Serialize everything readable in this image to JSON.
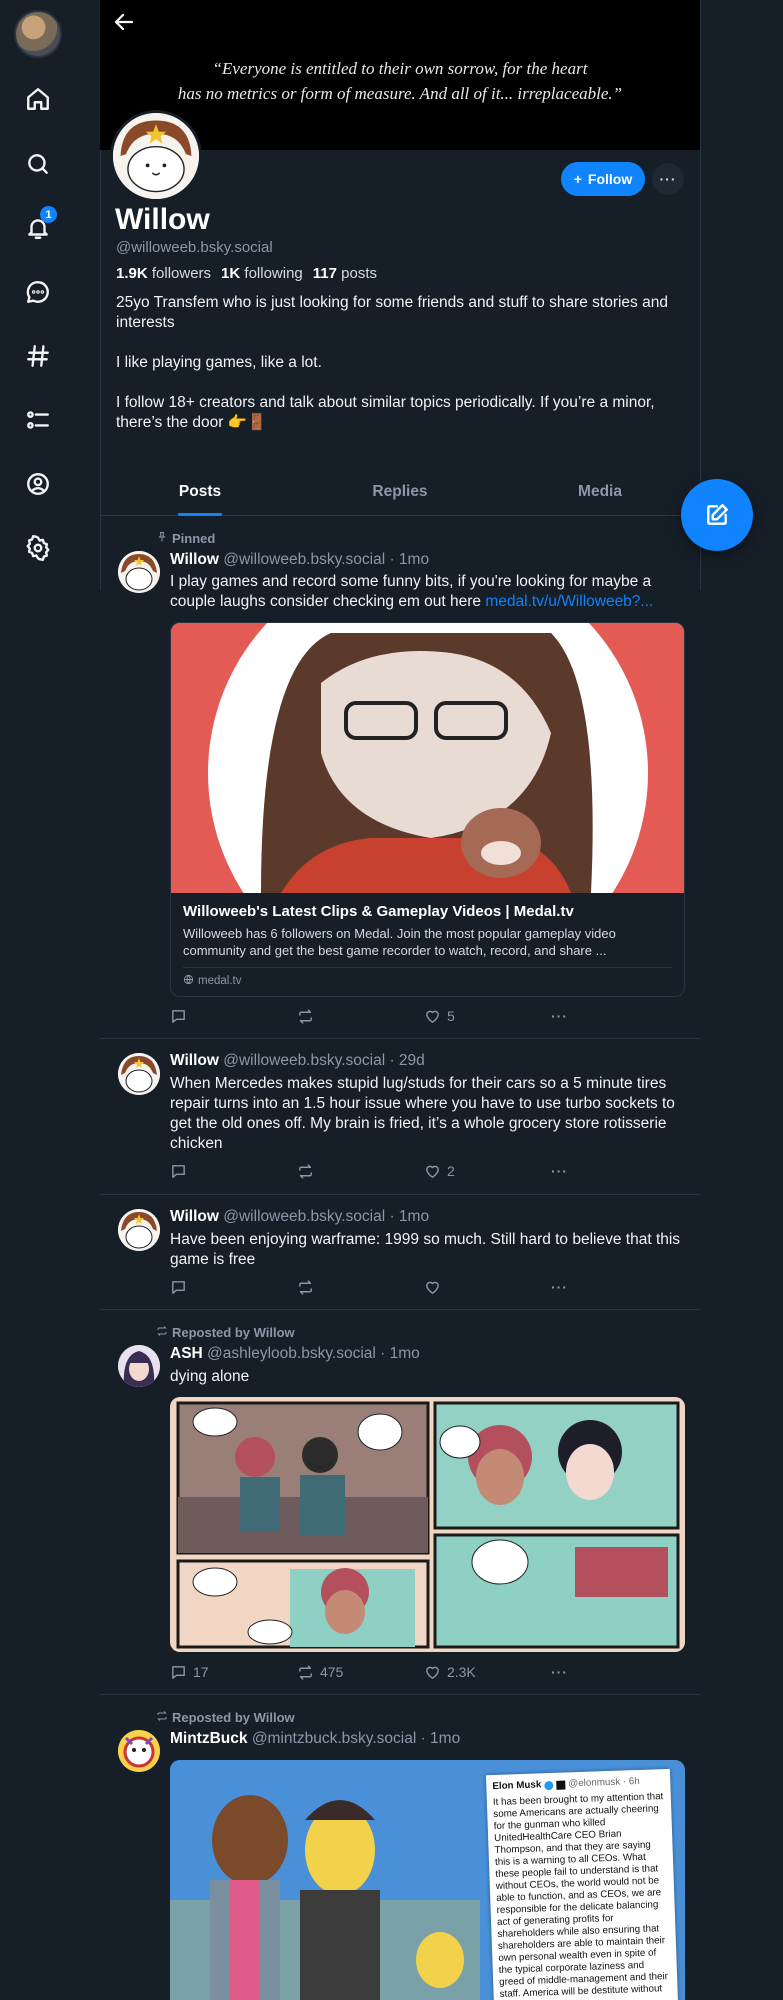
{
  "nav": {
    "notifications_badge": "1"
  },
  "banner": {
    "quote": "“Everyone is entitled to their own sorrow, for the heart\nhas no metrics or form of measure. And all of it... irreplaceable.”"
  },
  "profile": {
    "display_name": "Willow",
    "handle": "@willoweeb.bsky.social",
    "followers_count": "1.9K",
    "followers_label": "followers",
    "following_count": "1K",
    "following_label": "following",
    "posts_count": "117",
    "posts_label": "posts",
    "bio": [
      "25yo Transfem who is just looking for some friends and stuff to share stories and interests",
      "I like playing games, like a lot.",
      "",
      "I follow 18+ creators and talk about similar topics periodically. If you’re a minor, there’s the door 👉🚪"
    ],
    "follow_label": "Follow",
    "more_label": "···"
  },
  "tabs": [
    "Posts",
    "Replies",
    "Media"
  ],
  "feed": [
    {
      "meta": "Pinned",
      "author": "Willow",
      "handle": "@willoweeb.bsky.social · 1mo",
      "text": "I play games and record some funny bits, if you're looking for maybe a couple laughs consider checking em out here ",
      "link": "medal.tv/u/Willoweeb?...",
      "embed": {
        "title": "Willoweeb's Latest Clips & Gameplay Videos | Medal.tv",
        "description": "Willoweeb has 6 followers on Medal. Join the most popular gameplay video community and get the best game recorder to watch, record, and share ...",
        "domain": "medal.tv"
      },
      "replies": "",
      "reposts": "",
      "likes": "5"
    },
    {
      "author": "Willow",
      "handle": "@willoweeb.bsky.social · 29d",
      "text": "When Mercedes makes stupid lug/studs for their cars so a 5 minute tires repair turns into an 1.5 hour issue where you have to use turbo sockets to get the old ones off. My brain is fried, it’s a whole grocery store rotisserie chicken",
      "replies": "",
      "reposts": "",
      "likes": "2"
    },
    {
      "author": "Willow",
      "handle": "@willoweeb.bsky.social · 1mo",
      "text": "Have been enjoying warframe: 1999 so much. Still hard to believe that this game is free",
      "replies": "",
      "reposts": "",
      "likes": ""
    },
    {
      "meta": "Reposted by Willow",
      "author": "ASH",
      "handle": "@ashleyloob.bsky.social · 1mo",
      "text": "dying alone",
      "replies": "17",
      "reposts": "475",
      "likes": "2.3K"
    },
    {
      "meta": "Reposted by Willow",
      "author": "MintzBuck",
      "handle": "@mintzbuck.bsky.social · 1mo",
      "image_text": {
        "name": "Elon Musk",
        "handle": "@elonmusk · 6h",
        "body": "It has been brought to my attention that some Americans are actually cheering for the gunman who killed UnitedHealthCare CEO Brian Thompson, and that they are saying this is a warning to all CEOs. What these people fail to understand is that without CEOs, the world would not be able to function, and as CEOs, we are responsible for the delicate balancing act of generating profits for shareholders while also ensuring that shareholders are able to maintain their own personal wealth even in spite of the typical corporate laziness and greed of middle-management and their staff. America will be destitute without us. #DOGE"
      }
    }
  ],
  "dots": "···"
}
